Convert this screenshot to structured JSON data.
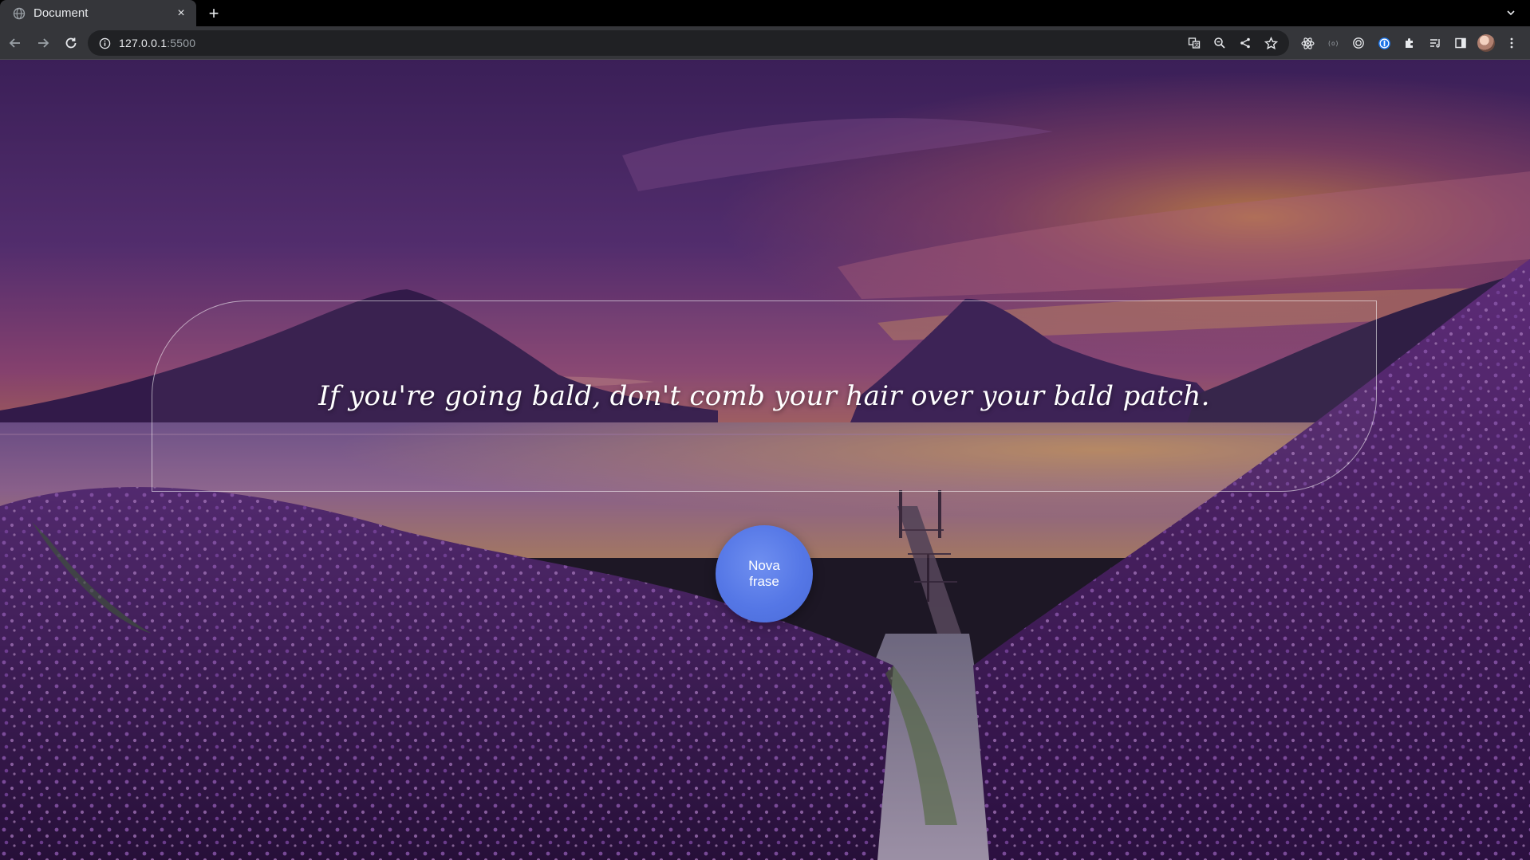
{
  "browser": {
    "tab": {
      "title": "Document",
      "close_glyph": "×"
    },
    "newtab_glyph": "+",
    "omnibox": {
      "host": "127.0.0.1",
      "port": ":5500"
    }
  },
  "page": {
    "quote": "If you're going bald, don't comb your hair over your bald patch.",
    "new_button_label": "Nova frase"
  },
  "icons": {
    "tab_favicon": "globe-icon",
    "back": "arrow-left-icon",
    "forward": "arrow-right-icon",
    "reload": "reload-icon",
    "site_info": "info-icon",
    "translate": "translate-icon",
    "zoom": "zoom-icon",
    "share": "share-icon",
    "bookmark": "star-icon",
    "extensions": "puzzle-icon"
  },
  "colors": {
    "chrome_dark": "#202124",
    "chrome_toolbar": "#35363a",
    "button_blue": "#5577e6"
  }
}
